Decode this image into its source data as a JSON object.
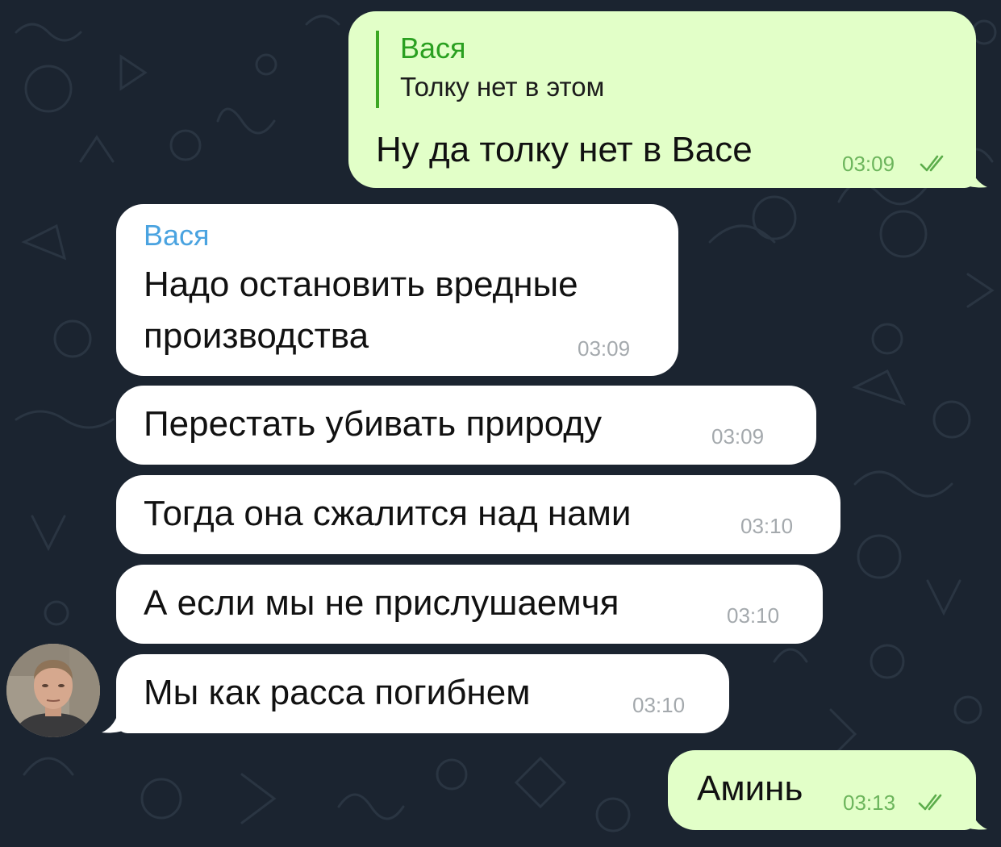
{
  "chat": {
    "messages": [
      {
        "id": "m1",
        "direction": "outgoing",
        "reply_to": {
          "name": "Вася",
          "text": "Толку нет в этом"
        },
        "text": "Ну да толку нет в Васе",
        "time": "03:09",
        "status": "read"
      },
      {
        "id": "m2",
        "direction": "incoming",
        "sender": "Вася",
        "lines": [
          "Надо остановить вредные",
          "производства"
        ],
        "time": "03:09"
      },
      {
        "id": "m3",
        "direction": "incoming",
        "text": "Перестать убивать природу",
        "time": "03:09"
      },
      {
        "id": "m4",
        "direction": "incoming",
        "text": "Тогда она сжалится над нами",
        "time": "03:10"
      },
      {
        "id": "m5",
        "direction": "incoming",
        "text": "А если мы не прислушаемчя",
        "time": "03:10"
      },
      {
        "id": "m6",
        "direction": "incoming",
        "text": "Мы как расса погибнем",
        "time": "03:10"
      },
      {
        "id": "m7",
        "direction": "outgoing",
        "text": "Аминь",
        "time": "03:13",
        "status": "read"
      }
    ]
  },
  "colors": {
    "background": "#1b2430",
    "outgoing_bubble": "#e2ffc8",
    "incoming_bubble": "#ffffff",
    "reply_accent": "#3ca823",
    "sender_name": "#4aa3e0",
    "outgoing_time": "#6cb55c",
    "incoming_time": "#a4a9ad"
  },
  "icons": {
    "read_receipt": "double-check-icon",
    "avatar": "sender-avatar"
  }
}
